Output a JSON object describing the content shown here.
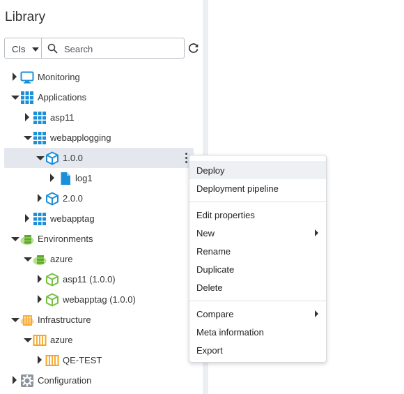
{
  "sidebar": {
    "title": "Library",
    "ci_select": {
      "value": "CIs"
    },
    "search": {
      "placeholder": "Search",
      "value": ""
    },
    "refresh_icon": "refresh-icon"
  },
  "tree": [
    {
      "label": "Monitoring",
      "expanded": false,
      "icon": "monitor-icon",
      "depth": 0
    },
    {
      "label": "Applications",
      "expanded": true,
      "icon": "grid-icon",
      "depth": 0
    },
    {
      "label": "asp11",
      "expanded": false,
      "icon": "grid-icon",
      "depth": 1
    },
    {
      "label": "webapplogging",
      "expanded": true,
      "icon": "grid-icon",
      "depth": 1
    },
    {
      "label": "1.0.0",
      "expanded": true,
      "icon": "package-icon",
      "depth": 2,
      "selected": true
    },
    {
      "label": "log1",
      "expanded": false,
      "icon": "file-icon",
      "depth": 3
    },
    {
      "label": "2.0.0",
      "expanded": false,
      "icon": "package-icon",
      "depth": 2
    },
    {
      "label": "webapptag",
      "expanded": false,
      "icon": "grid-icon",
      "depth": 1
    },
    {
      "label": "Environments",
      "expanded": true,
      "icon": "environment-icon",
      "depth": 0
    },
    {
      "label": "azure",
      "expanded": true,
      "icon": "environment-icon",
      "depth": 1
    },
    {
      "label": "asp11 (1.0.0)",
      "expanded": false,
      "icon": "green-package-icon",
      "depth": 2
    },
    {
      "label": "webapptag (1.0.0)",
      "expanded": false,
      "icon": "green-package-icon",
      "depth": 2
    },
    {
      "label": "Infrastructure",
      "expanded": true,
      "icon": "infrastructure-icon",
      "depth": 0
    },
    {
      "label": "azure",
      "expanded": true,
      "icon": "server-icon",
      "depth": 1
    },
    {
      "label": "QE-TEST",
      "expanded": false,
      "icon": "server-icon",
      "depth": 2
    },
    {
      "label": "Configuration",
      "expanded": false,
      "icon": "gear-icon",
      "depth": 0
    }
  ],
  "context_menu": {
    "items": [
      {
        "label": "Deploy",
        "highlighted": true
      },
      {
        "label": "Deployment pipeline"
      },
      {
        "label": "Edit properties"
      },
      {
        "label": "New",
        "submenu": true
      },
      {
        "label": "Rename"
      },
      {
        "label": "Duplicate"
      },
      {
        "label": "Delete"
      },
      {
        "label": "Compare",
        "submenu": true
      },
      {
        "label": "Meta information"
      },
      {
        "label": "Export"
      }
    ]
  },
  "colors": {
    "blue": "#1b8fd8",
    "green": "#77c043",
    "orange": "#f5a623",
    "grey": "#8c959e",
    "selected_bg": "#e4e8ee",
    "gutter": "#eceff2"
  }
}
